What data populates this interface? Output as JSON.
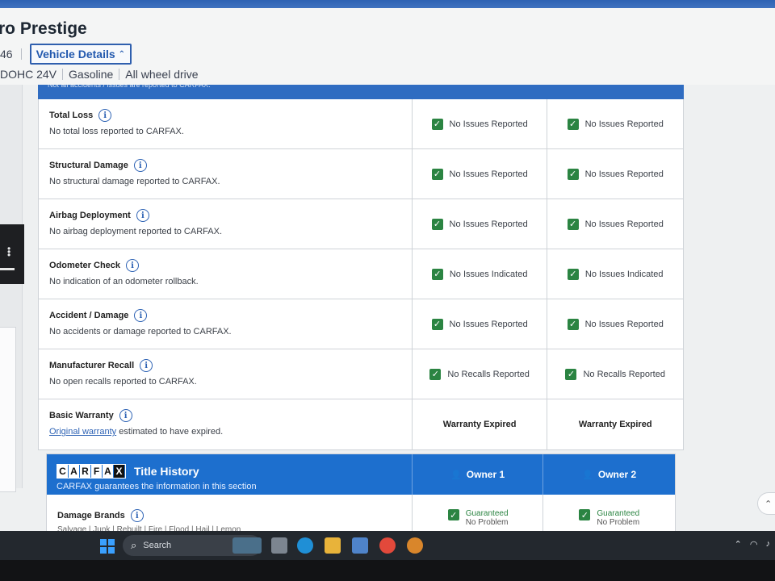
{
  "header": {
    "vehicle_title": "ro Prestige",
    "vin_suffix": "46",
    "vehicle_details_button": "Vehicle Details",
    "specs": [
      "DOHC 24V",
      "Gasoline",
      "All wheel drive"
    ]
  },
  "report": {
    "header_note": "Not all accidents / issues are reported to CARFAX.",
    "rows": [
      {
        "title": "Total Loss",
        "desc": "No total loss reported to CARFAX.",
        "owner1": "No Issues Reported",
        "owner2": "No Issues Reported"
      },
      {
        "title": "Structural Damage",
        "desc": "No structural damage reported to CARFAX.",
        "owner1": "No Issues Reported",
        "owner2": "No Issues Reported"
      },
      {
        "title": "Airbag Deployment",
        "desc": "No airbag deployment reported to CARFAX.",
        "owner1": "No Issues Reported",
        "owner2": "No Issues Reported"
      },
      {
        "title": "Odometer Check",
        "desc": "No indication of an odometer rollback.",
        "owner1": "No Issues Indicated",
        "owner2": "No Issues Indicated"
      },
      {
        "title": "Accident / Damage",
        "desc": "No accidents or damage reported to CARFAX.",
        "owner1": "No Issues Reported",
        "owner2": "No Issues Reported"
      },
      {
        "title": "Manufacturer Recall",
        "desc": "No open recalls reported to CARFAX.",
        "owner1": "No Recalls Reported",
        "owner2": "No Recalls Reported"
      }
    ],
    "warranty": {
      "title": "Basic Warranty",
      "desc_link": "Original warranty",
      "desc_rest": " estimated to have expired.",
      "owner1": "Warranty Expired",
      "owner2": "Warranty Expired"
    }
  },
  "title_history": {
    "logo_letters": [
      "C",
      "A",
      "R",
      "F",
      "A",
      "X"
    ],
    "title": "Title History",
    "subtitle": "CARFAX guarantees the information in this section",
    "owner1": "Owner 1",
    "owner2": "Owner 2",
    "damage_brands": {
      "title": "Damage Brands",
      "brands": "Salvage | Junk | Rebuilt | Fire | Flood | Hail | Lemon",
      "g_label": "Guaranteed",
      "g_value": "No Problem"
    }
  },
  "taskbar": {
    "search_label": "Search"
  },
  "colors": {
    "brand_blue": "#1d6fce",
    "check_green": "#2b8442"
  }
}
